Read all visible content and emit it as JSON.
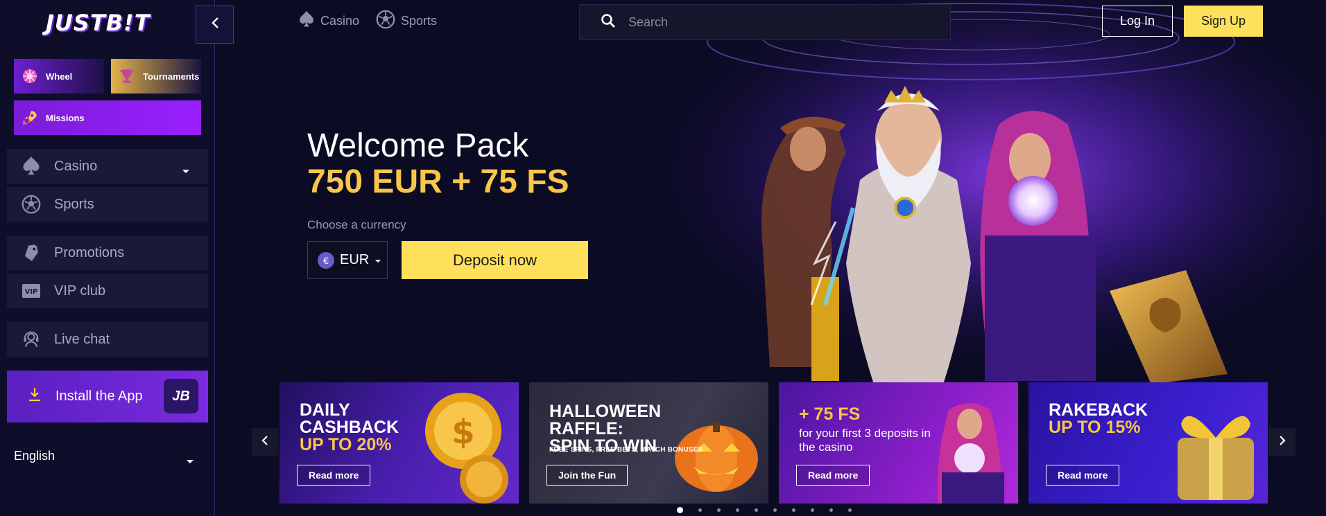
{
  "brand": {
    "logo": "JUSTB!T"
  },
  "sidebar": {
    "promos": [
      {
        "label": "Wheel",
        "icon": "wheel-icon"
      },
      {
        "label": "Tournaments",
        "icon": "trophy-icon"
      },
      {
        "label": "Missions",
        "icon": "rocket-icon"
      }
    ],
    "nav": [
      {
        "label": "Casino",
        "icon": "spade-icon"
      },
      {
        "label": "Sports",
        "icon": "soccer-ball-icon"
      },
      {
        "label": "Promotions",
        "icon": "tag-icon"
      },
      {
        "label": "VIP club",
        "icon": "vip-icon"
      },
      {
        "label": "Live chat",
        "icon": "headset-icon"
      }
    ],
    "install": {
      "label": "Install the App",
      "badge": "JB"
    },
    "language": "English"
  },
  "header": {
    "tabs": [
      {
        "label": "Casino",
        "icon": "spade-icon"
      },
      {
        "label": "Sports",
        "icon": "soccer-ball-icon"
      }
    ],
    "search": {
      "placeholder": "Search"
    },
    "login_label": "Log In",
    "signup_label": "Sign Up"
  },
  "hero": {
    "title": "Welcome Pack",
    "amount": "750 EUR + 75 FS",
    "currency_label": "Choose a currency",
    "currency": {
      "symbol": "€",
      "value": "EUR"
    },
    "deposit_label": "Deposit now"
  },
  "cards": [
    {
      "title": "DAILY\nCASHBACK",
      "subtitle": "UP TO 20%",
      "button": "Read more"
    },
    {
      "title": "HALLOWEEN RAFFLE:\nSPIN TO WIN",
      "small": "FREE SPINS, FREE BETS, MATCH BONUSES",
      "button": "Join the Fun"
    },
    {
      "title": "+ 75 FS",
      "desc": "for your first 3 deposits in the casino",
      "button": "Read more"
    },
    {
      "title": "RAKEBACK",
      "subtitle": "UP TO 15%",
      "button": "Read more"
    }
  ],
  "carousel": {
    "dot_count": 10,
    "active_index": 0
  },
  "colors": {
    "accent_yellow": "#ffe05a",
    "gold_text": "#f7c64a",
    "purple": "#7a2ae0",
    "background": "#0b0b24"
  }
}
